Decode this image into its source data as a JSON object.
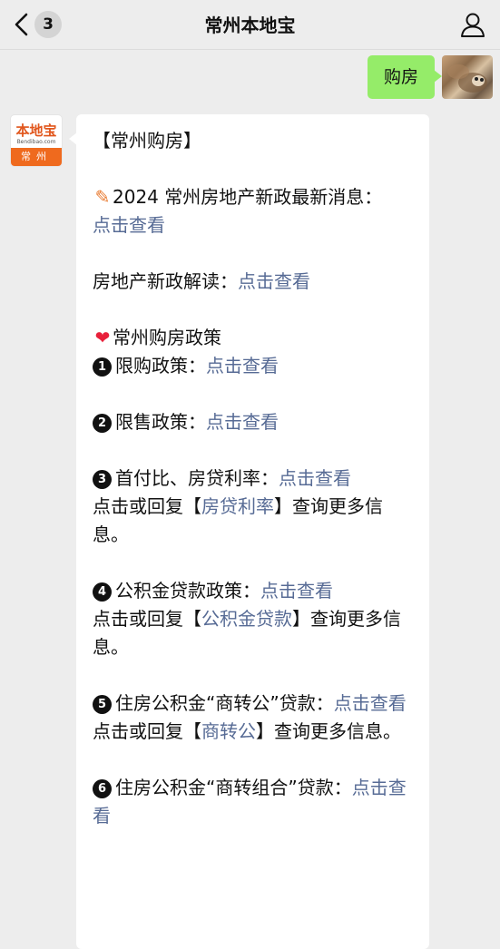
{
  "header": {
    "title": "常州本地宝",
    "unread_count": "3"
  },
  "outgoing": {
    "text": "购房"
  },
  "bot": {
    "logo_top": "本地宝",
    "logo_mid": "Bendibao.com",
    "logo_bottom": "常州"
  },
  "message": {
    "heading": "【常州购房】",
    "news_label": "2024 常州房地产新政最新消息：",
    "news_link": "点击查看",
    "interpret_label": "房地产新政解读：",
    "interpret_link": "点击查看",
    "policy_heading": "常州购房政策",
    "items": [
      {
        "num": "1",
        "label": "限购政策：",
        "link": "点击查看"
      },
      {
        "num": "2",
        "label": "限售政策：",
        "link": "点击查看"
      },
      {
        "num": "3",
        "label": "首付比、房贷利率：",
        "link": "点击查看",
        "reply_prefix": "点击或回复【",
        "reply_keyword": "房贷利率",
        "reply_suffix": "】查询更多信息。"
      },
      {
        "num": "4",
        "label": "公积金贷款政策：",
        "link": "点击查看",
        "reply_prefix": "点击或回复【",
        "reply_keyword": "公积金贷款",
        "reply_suffix": "】查询更多信息。"
      },
      {
        "num": "5",
        "label": "住房公积金“商转公”贷款：",
        "link": "点击查看",
        "reply_prefix": "点击或回复【",
        "reply_keyword": "商转公",
        "reply_suffix": "】查询更多信息。"
      },
      {
        "num": "6",
        "label": "住房公积金“商转组合”贷款：",
        "link": "点击查看"
      }
    ]
  },
  "icons": {
    "news": "pen-icon",
    "policy": "heart-icon"
  },
  "colors": {
    "link": "#576b95",
    "outgoing_bubble": "#95ec69",
    "background": "#ededed"
  }
}
